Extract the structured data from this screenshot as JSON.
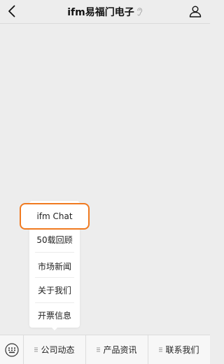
{
  "header": {
    "title": "ifm易福门电子",
    "back_icon": "chevron-left-icon",
    "mute_icon": "ear-icon",
    "profile_icon": "person-icon"
  },
  "popup": {
    "items": [
      {
        "label": "ifm Chat",
        "highlighted": true
      },
      {
        "label": "50载回顾"
      },
      {
        "label": "市场新闻"
      },
      {
        "label": "关于我们"
      },
      {
        "label": "开票信息"
      }
    ],
    "highlight_color": "#f07a20"
  },
  "bottom_menu": {
    "keyboard_icon": "keyboard-icon",
    "tabs": [
      {
        "label": "公司动态"
      },
      {
        "label": "产品资讯"
      },
      {
        "label": "联系我们"
      }
    ]
  },
  "colors": {
    "background": "#ededed",
    "popup_bg": "#ffffff",
    "bar_bg": "#f7f7f7"
  }
}
